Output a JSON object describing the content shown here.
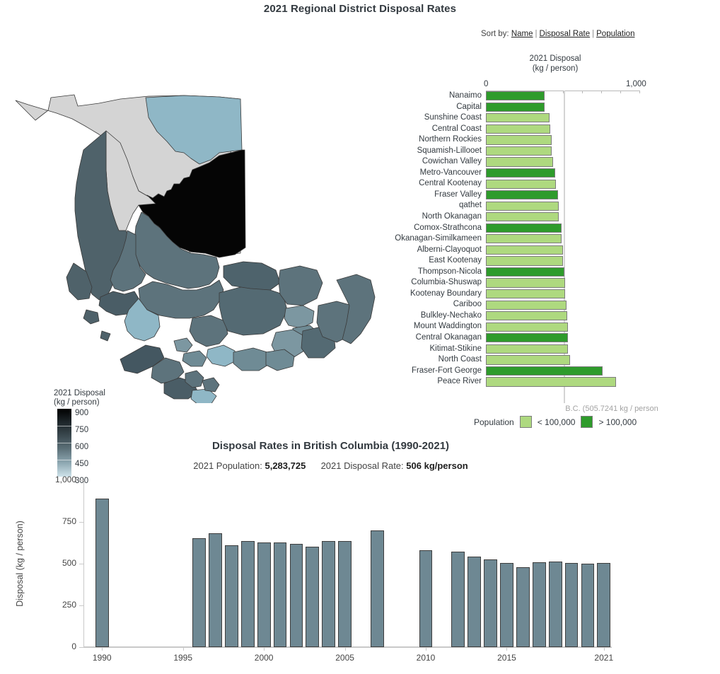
{
  "header": {
    "title": "2021 Regional District Disposal Rates"
  },
  "sort_by": {
    "label": "Sort by:",
    "options": [
      "Name",
      "Disposal Rate",
      "Population"
    ],
    "separator": "|"
  },
  "map": {
    "legend_title_line1": "2021 Disposal",
    "legend_title_line2": "(kg / person)",
    "legend_ticks": [
      "900",
      "750",
      "600",
      "450",
      "300"
    ],
    "color_high": "#000000",
    "color_low": "#cfe3ea",
    "no_data_color": "#d4d4d4"
  },
  "bar_chart": {
    "axis_title_line1": "2021 Disposal",
    "axis_title_line2": "(kg / person)",
    "axis_min_label": "0",
    "axis_max_label": "1,000",
    "reference_label": "B.C. (505.7241 kg / person",
    "reference_value": 505.7241,
    "legend_title": "Population",
    "legend_small_label": "< 100,000",
    "legend_large_label": "> 100,000",
    "color_small": "#aed97f",
    "color_large": "#2e9b2b"
  },
  "chart_data": [
    {
      "type": "bar",
      "orientation": "horizontal",
      "title": "2021 Disposal (kg / person)",
      "xlabel": "2021 Disposal (kg / person)",
      "ylabel": "",
      "xlim": [
        0,
        1000
      ],
      "grid": false,
      "sorted_by": "Name",
      "reference_line": {
        "label": "B.C. (505.7241 kg / person",
        "value": 505.7241
      },
      "legend": {
        "position": "bottom",
        "entries": [
          "< 100,000",
          "> 100,000"
        ]
      },
      "categories": [
        "Nanaimo",
        "Capital",
        "Sunshine Coast",
        "Central Coast",
        "Northern Rockies",
        "Squamish-Lillooet",
        "Cowichan Valley",
        "Metro-Vancouver",
        "Central Kootenay",
        "Fraser Valley",
        "qathet",
        "North Okanagan",
        "Comox-Strathcona",
        "Okanagan-Similkameen",
        "Alberni-Clayoquot",
        "East Kootenay",
        "Thompson-Nicola",
        "Columbia-Shuswap",
        "Kootenay Boundary",
        "Cariboo",
        "Bulkley-Nechako",
        "Mount Waddington",
        "Central Okanagan",
        "Kitimat-Stikine",
        "North Coast",
        "Fraser-Fort George",
        "Peace River"
      ],
      "values": [
        380,
        383,
        412,
        417,
        426,
        427,
        435,
        450,
        456,
        470,
        472,
        473,
        490,
        492,
        500,
        500,
        510,
        512,
        514,
        524,
        527,
        530,
        533,
        534,
        546,
        757,
        845
      ],
      "population_class": [
        "large",
        "large",
        "small",
        "small",
        "small",
        "small",
        "small",
        "large",
        "small",
        "large",
        "small",
        "small",
        "large",
        "small",
        "small",
        "small",
        "large",
        "small",
        "small",
        "small",
        "small",
        "small",
        "large",
        "small",
        "small",
        "large",
        "small"
      ]
    },
    {
      "type": "bar",
      "orientation": "vertical",
      "title": "Disposal Rates in British Columbia (1990-2021)",
      "xlabel": "",
      "ylabel": "Disposal (kg / person)",
      "ylim": [
        0,
        1000
      ],
      "yticks": [
        "0",
        "250",
        "500",
        "750",
        "1,000"
      ],
      "xticks": [
        "1990",
        "1995",
        "2000",
        "2005",
        "2010",
        "2015",
        "2021"
      ],
      "grid": false,
      "bar_color": "#6e8893",
      "x": [
        1990,
        1996,
        1997,
        1998,
        1999,
        2000,
        2001,
        2002,
        2003,
        2004,
        2005,
        2007,
        2010,
        2012,
        2013,
        2014,
        2015,
        2016,
        2017,
        2018,
        2019,
        2020,
        2021
      ],
      "values": [
        888,
        652,
        684,
        611,
        635,
        629,
        627,
        617,
        600,
        634,
        637,
        701,
        580,
        570,
        542,
        524,
        506,
        478,
        510,
        511,
        504,
        502,
        506
      ]
    }
  ],
  "time_series_panel": {
    "title": "Disposal Rates in British Columbia (1990-2021)",
    "population_label": "2021 Population:",
    "population_value": "5,283,725",
    "rate_label": "2021 Disposal Rate:",
    "rate_value": "506 kg/person"
  }
}
